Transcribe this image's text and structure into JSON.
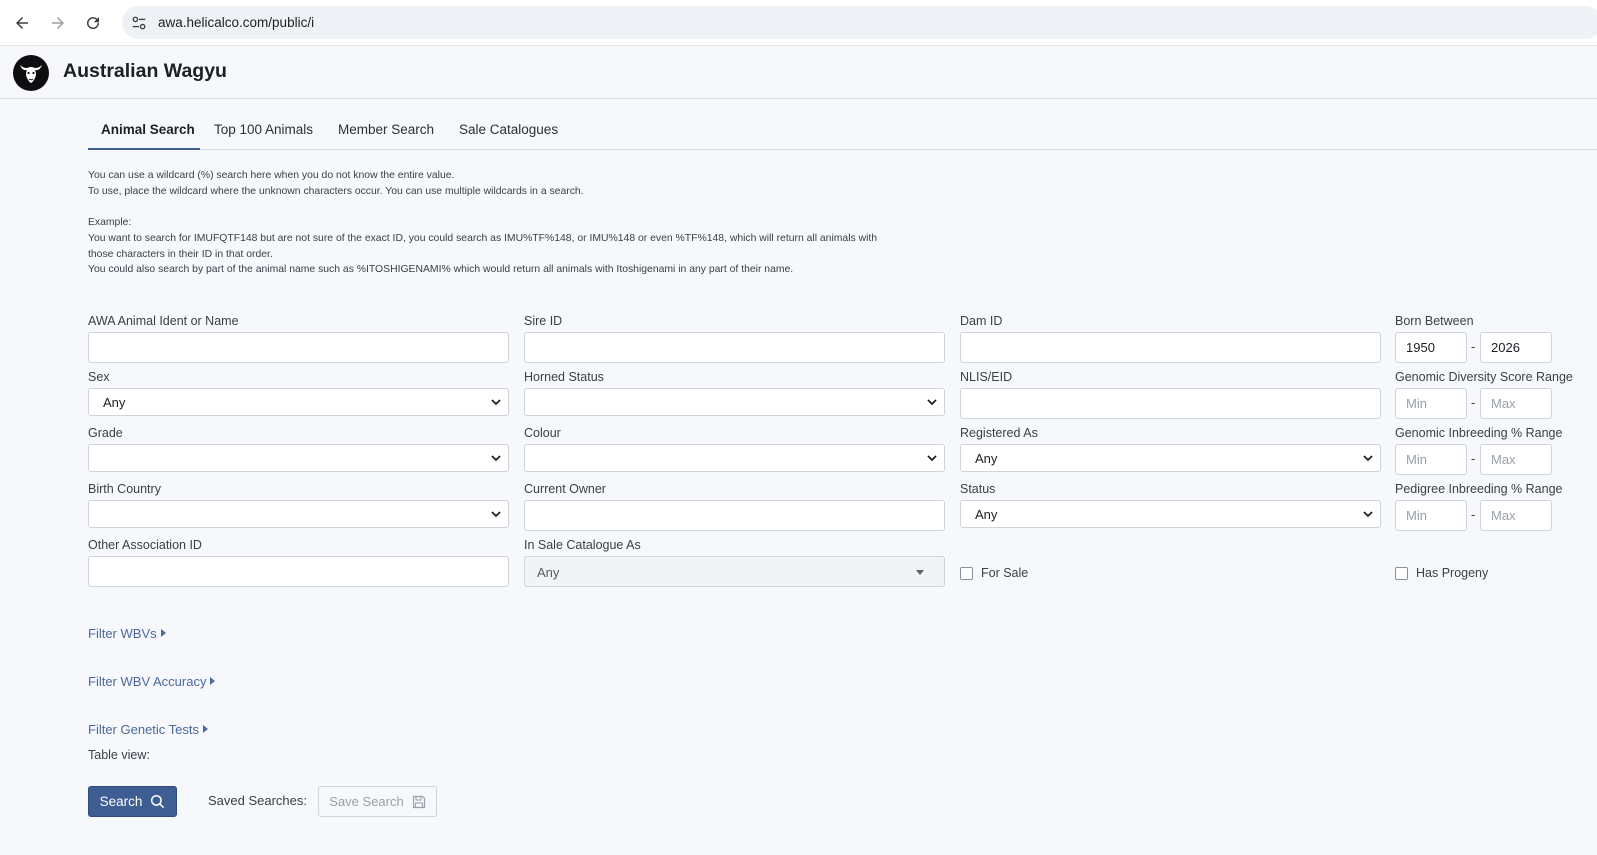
{
  "browser": {
    "url": "awa.helicalco.com/public/i",
    "icons": [
      "back-arrow-icon",
      "forward-arrow-icon",
      "reload-icon",
      "site-settings-icon"
    ]
  },
  "header": {
    "title": "Australian Wagyu",
    "logo_icon": "bull-head-logo"
  },
  "tabs": [
    {
      "label": "Animal Search",
      "active": true
    },
    {
      "label": "Top 100 Animals",
      "active": false
    },
    {
      "label": "Member Search",
      "active": false
    },
    {
      "label": "Sale Catalogues",
      "active": false
    }
  ],
  "info": {
    "line1": "You can use a wildcard (%) search here when you do not know the entire value.",
    "line2": "To use, place the wildcard where the unknown characters occur. You can use multiple wildcards in a search.",
    "line3": "Example:",
    "line4": "You want to search for IMUFQTF148 but are not sure of the exact ID, you could search as IMU%TF%148, or IMU%148 or even %TF%148, which will return all animals with",
    "line5": "those characters in their ID in that order.",
    "line6": "You could also search by part of the animal name such as %ITOSHIGENAMI% which would return all animals with Itoshigenami in any part of their name."
  },
  "form": {
    "awa_ident": {
      "label": "AWA Animal Ident or Name",
      "value": ""
    },
    "sire_id": {
      "label": "Sire ID",
      "value": ""
    },
    "dam_id": {
      "label": "Dam ID",
      "value": ""
    },
    "born_between": {
      "label": "Born Between",
      "from": "1950",
      "to": "2026",
      "sep": "-"
    },
    "sex": {
      "label": "Sex",
      "value": "Any"
    },
    "horned_status": {
      "label": "Horned Status",
      "value": ""
    },
    "nlis_eid": {
      "label": "NLIS/EID",
      "value": ""
    },
    "genomic_diversity": {
      "label": "Genomic Diversity Score Range",
      "min_placeholder": "Min",
      "max_placeholder": "Max",
      "sep": "-"
    },
    "grade": {
      "label": "Grade",
      "value": ""
    },
    "colour": {
      "label": "Colour",
      "value": ""
    },
    "registered_as": {
      "label": "Registered As",
      "value": "Any"
    },
    "genomic_inbreeding": {
      "label": "Genomic Inbreeding % Range",
      "min_placeholder": "Min",
      "max_placeholder": "Max",
      "sep": "-"
    },
    "birth_country": {
      "label": "Birth Country",
      "value": ""
    },
    "current_owner": {
      "label": "Current Owner",
      "value": ""
    },
    "status": {
      "label": "Status",
      "value": "Any"
    },
    "pedigree_inbreeding": {
      "label": "Pedigree Inbreeding % Range",
      "min_placeholder": "Min",
      "max_placeholder": "Max",
      "sep": "-"
    },
    "other_assoc_id": {
      "label": "Other Association ID",
      "value": ""
    },
    "in_sale_catalogue": {
      "label": "In Sale Catalogue As",
      "value": "Any"
    },
    "for_sale": {
      "label": "For Sale",
      "checked": false
    },
    "has_progeny": {
      "label": "Has Progeny",
      "checked": false
    }
  },
  "filters": {
    "wbvs": "Filter WBVs",
    "wbv_accuracy": "Filter WBV Accuracy",
    "genetic_tests": "Filter Genetic Tests"
  },
  "table_view_label": "Table view:",
  "actions": {
    "search_label": "Search",
    "saved_searches_label": "Saved Searches:",
    "save_search_label": "Save Search"
  },
  "colors": {
    "primary": "#3e5d93",
    "link": "#4a6a9b",
    "background": "#f6f8fb"
  }
}
